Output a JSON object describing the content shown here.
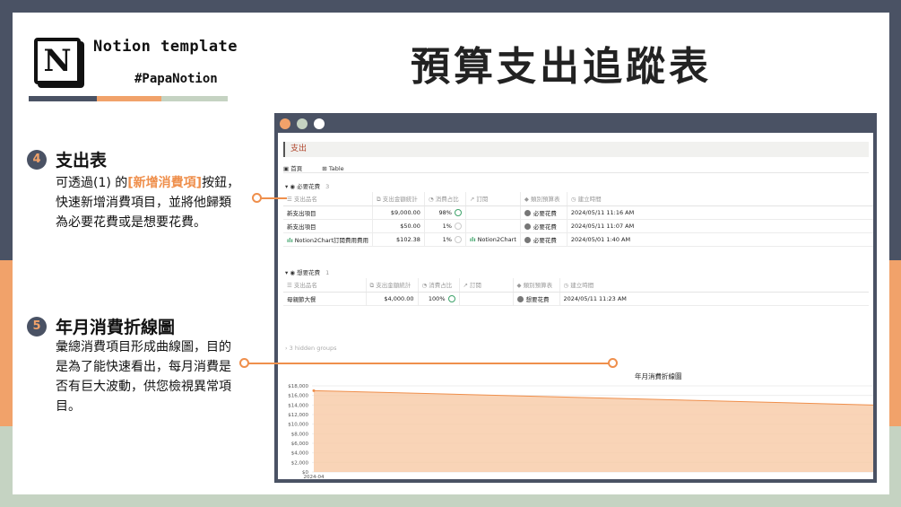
{
  "logo": {
    "letter": "N",
    "template_label": "Notion template",
    "handle": "#PapaNotion"
  },
  "page_title": "預算支出追蹤表",
  "colors": {
    "dark": "#4a5264",
    "orange": "#f1a26a",
    "sage": "#c5d3c2",
    "accent": "#ef8f4c"
  },
  "sections": [
    {
      "number": "4",
      "title": "支出表",
      "body_before": "可透過(1) 的",
      "body_highlight": "[新增消費項]",
      "body_after": "按鈕，快速新增消費項目，並將他歸類為必要花費或是想要花費。"
    },
    {
      "number": "5",
      "title": "年月消費折線圖",
      "body": "彙總消費項目形成曲線圖，目的是為了能快速看出，每月消費是否有巨大波動，供您檢視異常項目。"
    }
  ],
  "app": {
    "db_title": "支出",
    "tabs": [
      "首頁",
      "Table"
    ],
    "columns": [
      "支出品名",
      "支出金額統計",
      "消費占比",
      "訂閱",
      "類別預算表",
      "建立時間"
    ],
    "groups": [
      {
        "name": "必要花費",
        "count": "3",
        "rows": [
          {
            "name": "新支出項目",
            "amount": "$9,000.00",
            "pct": "98%",
            "sub": "",
            "category": "必要花費",
            "created": "2024/05/11 11:16 AM"
          },
          {
            "name": "新支出項目",
            "amount": "$50.00",
            "pct": "1%",
            "sub": "",
            "category": "必要花費",
            "created": "2024/05/11 11:07 AM"
          },
          {
            "name": "Notion2Chart訂閱費用費用",
            "amount": "$102.38",
            "pct": "1%",
            "sub": "Notion2Chart",
            "category": "必要花費",
            "created": "2024/05/01 1:40 AM"
          }
        ]
      },
      {
        "name": "想要花費",
        "count": "1",
        "rows": [
          {
            "name": "母親節大餐",
            "amount": "$4,000.00",
            "pct": "100%",
            "sub": "",
            "category": "想要花費",
            "created": "2024/05/11 11:23 AM"
          }
        ]
      }
    ],
    "hidden_groups": "3 hidden groups",
    "chart_title": "年月消費折線圖"
  },
  "chart_data": {
    "type": "area",
    "title": "年月消費折線圖",
    "x": [
      "2024-04",
      ""
    ],
    "values": [
      17000,
      14000
    ],
    "y_ticks": [
      "$16,000",
      "$14,000",
      "$12,000",
      "$10,000",
      "$8,000",
      "$6,000",
      "$4,000",
      "$2,000",
      "$0"
    ],
    "top_tick": "$18,000",
    "x_tick": "2024-04",
    "ylim": [
      0,
      18000
    ],
    "color": "#f7c9a5"
  }
}
